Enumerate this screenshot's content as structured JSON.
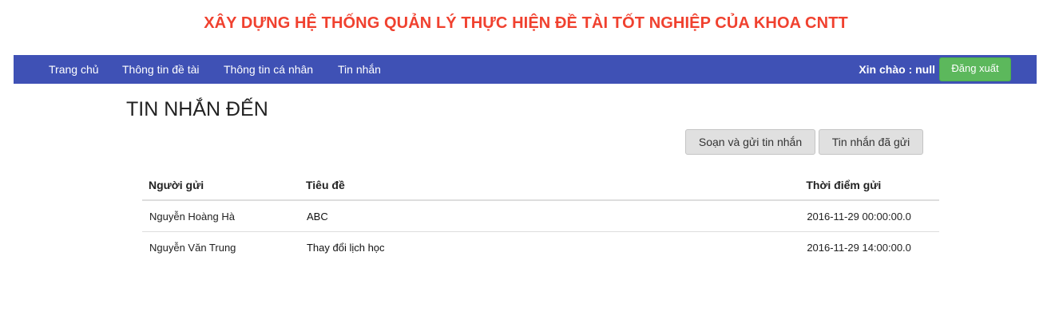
{
  "site": {
    "title": "XÂY DỰNG HỆ THỐNG QUẢN LÝ THỰC HIỆN ĐỀ TÀI TỐT NGHIỆP CỦA KHOA CNTT"
  },
  "navbar": {
    "items": [
      {
        "label": "Trang chủ"
      },
      {
        "label": "Thông tin đề tài"
      },
      {
        "label": "Thông tin cá nhân"
      },
      {
        "label": "Tin nhắn"
      }
    ],
    "greeting": "Xin chào : null",
    "logout_label": "Đăng xuất"
  },
  "page": {
    "heading": "TIN NHẮN ĐẾN",
    "compose_label": "Soạn và gửi tin nhắn",
    "sent_label": "Tin nhắn đã gửi"
  },
  "table": {
    "headers": [
      "Người gửi",
      "Tiêu đề",
      "Thời điểm gửi"
    ],
    "rows": [
      {
        "sender": "Nguyễn Hoàng Hà",
        "subject": "ABC",
        "time": "2016-11-29 00:00:00.0"
      },
      {
        "sender": "Nguyễn Văn Trung",
        "subject": "Thay đổi lịch học",
        "time": "2016-11-29 14:00:00.0"
      }
    ]
  },
  "colors": {
    "title_red": "#f0412f",
    "navbar_blue": "#3f51b5",
    "logout_green": "#5cb85c",
    "button_gray": "#e0e0e0"
  }
}
